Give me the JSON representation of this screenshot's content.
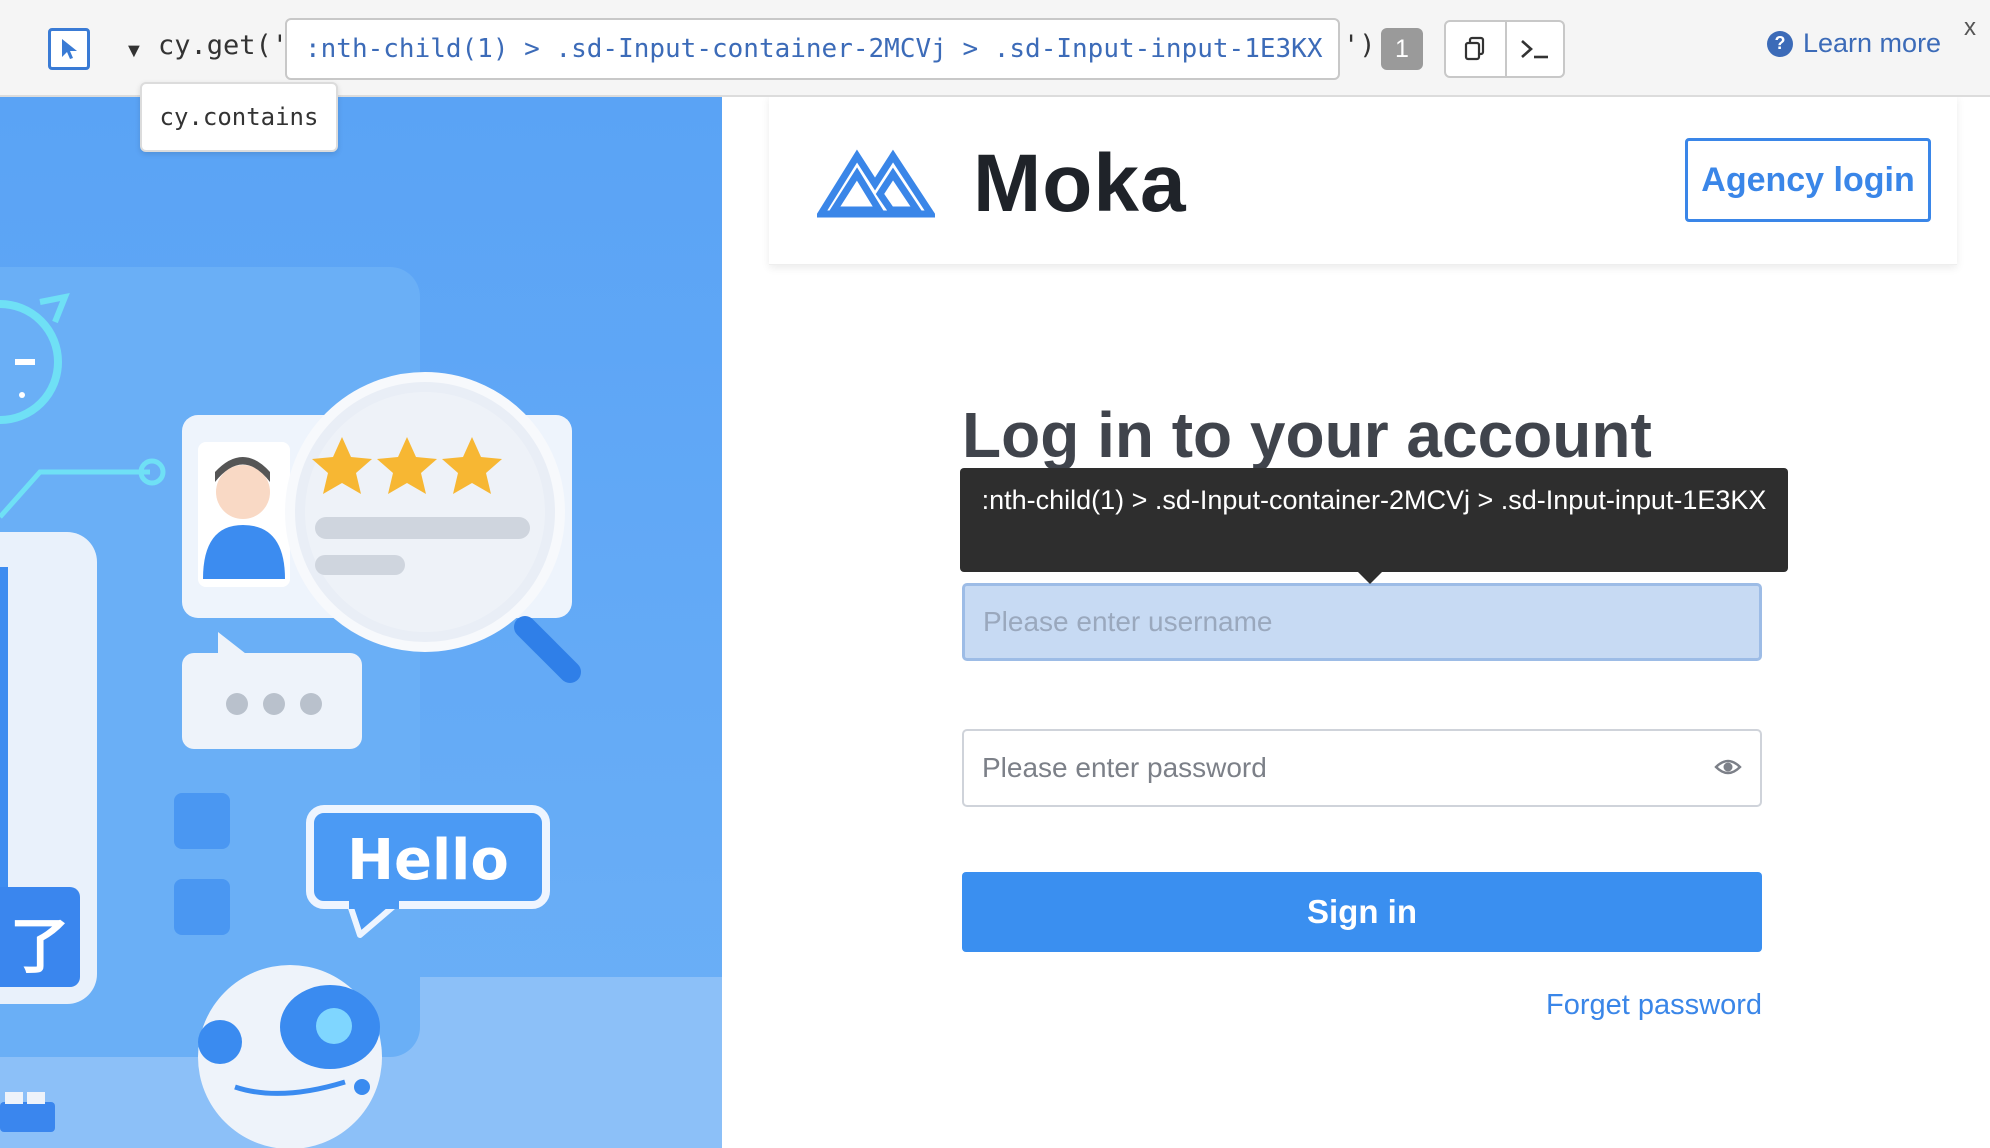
{
  "cypress": {
    "command_prefix": "cy.get('",
    "selector_value": ":nth-child(1) > .sd-Input-container-2MCVj > .sd-Input-input-1E3KX",
    "command_suffix": "')",
    "match_count": "1",
    "learn_more": "Learn more",
    "close_label": "x",
    "dropdown_option": "cy.contains",
    "icons": [
      "selector-target-icon",
      "caret-down-icon",
      "copy-icon",
      "terminal-icon",
      "question-circle-icon"
    ]
  },
  "header": {
    "brand": "Moka",
    "agency_login": "Agency login"
  },
  "login": {
    "title": "Log in to your account",
    "username_placeholder": "Please enter username",
    "password_placeholder": "Please enter password",
    "sign_in": "Sign in",
    "forget_password": "Forget password"
  },
  "tooltip": {
    "text": ":nth-child(1) > .sd-Input-container-2MCVj > .sd-Input-input-1E3KX"
  },
  "illustration": {
    "bubble_text": "Hello",
    "badge_char": "了",
    "stars": 3
  },
  "colors": {
    "accent": "#3a86e8",
    "button": "#3a8ff0",
    "panel": "#5ea7f5",
    "tooltip_bg": "#2e2e2e",
    "cypress_blue": "#3c6bb8"
  }
}
